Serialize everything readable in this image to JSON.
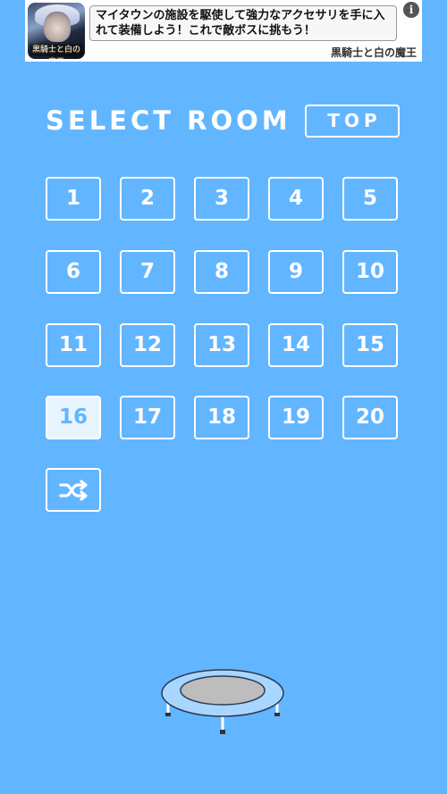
{
  "ad": {
    "thumbnail_logo": "黒騎士と白の魔王",
    "text": "マイタウンの施設を駆使して強力なアクセサリを手に入れて装備しよう！これで敵ボスに挑もう！",
    "source": "黒騎士と白の魔王",
    "info_icon": "i"
  },
  "header": {
    "title": "SELECT ROOM",
    "top_button": "TOP"
  },
  "rooms": [
    "1",
    "2",
    "3",
    "4",
    "5",
    "6",
    "7",
    "8",
    "9",
    "10",
    "11",
    "12",
    "13",
    "14",
    "15",
    "16",
    "17",
    "18",
    "19",
    "20"
  ],
  "current_room": "16",
  "shuffle_icon": "shuffle-icon",
  "decoration": "trampoline",
  "colors": {
    "background": "#62b6ff",
    "room_border": "#ffffff",
    "current_room_fill": "#e8f5ff"
  }
}
